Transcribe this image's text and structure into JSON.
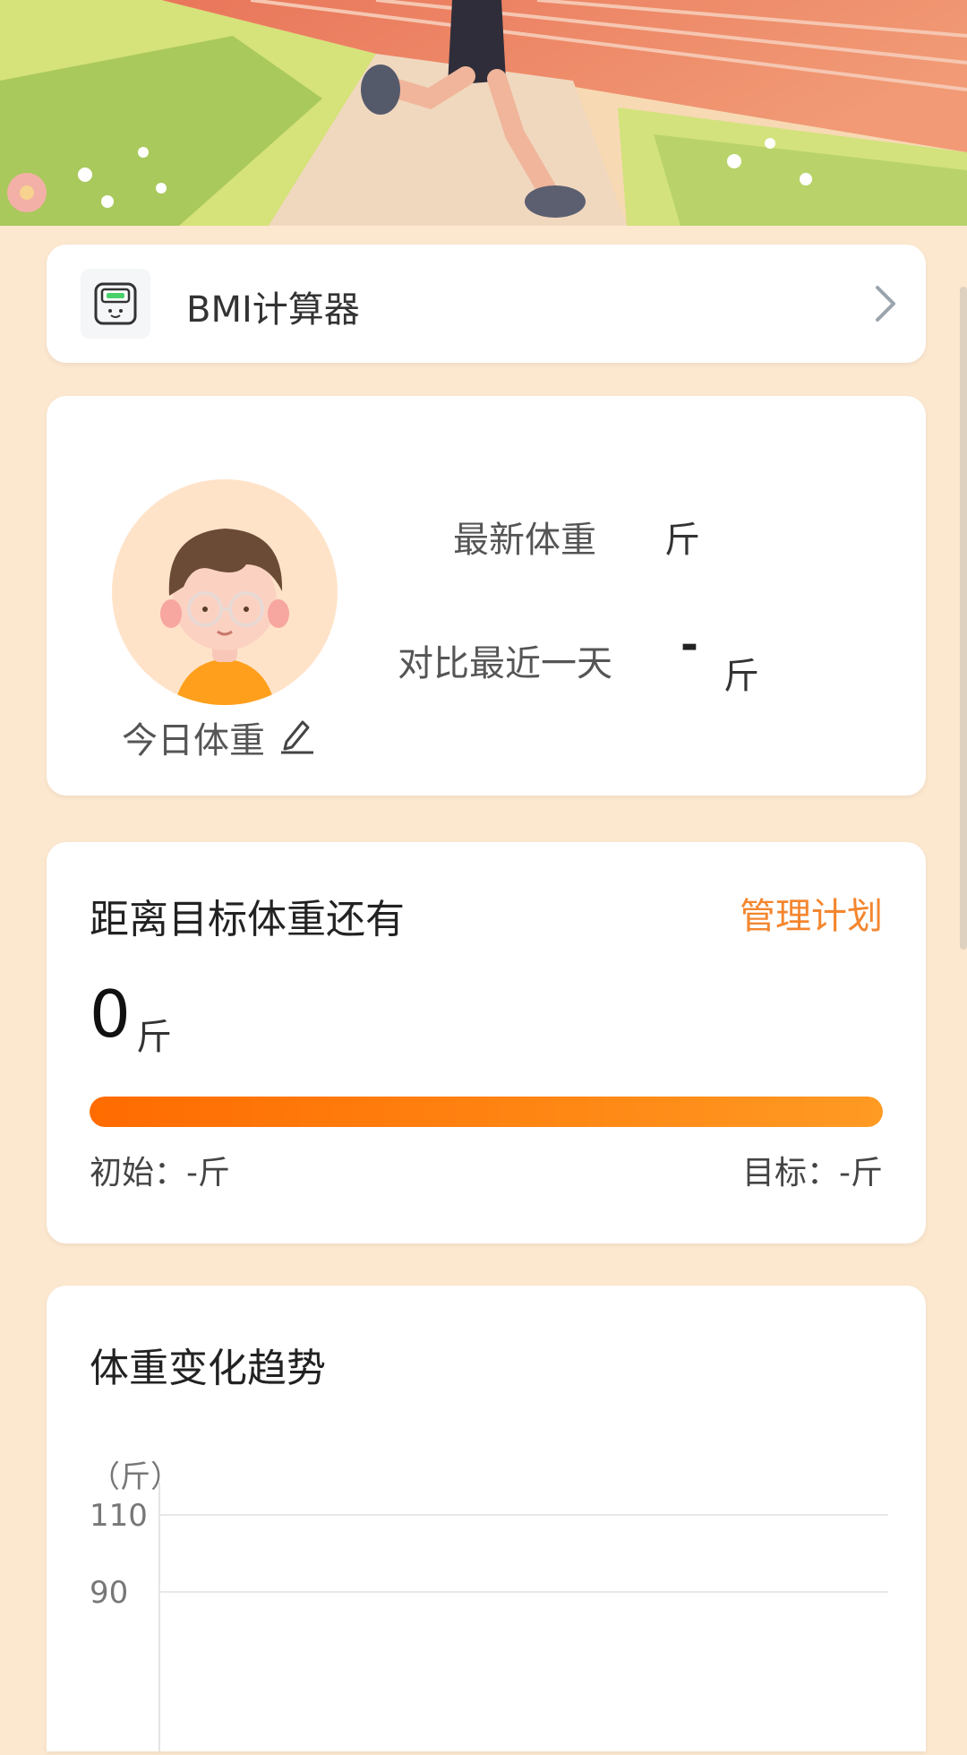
{
  "bmi": {
    "label": "BMI计算器"
  },
  "weight": {
    "latest_label": "最新体重",
    "latest_unit": "斤",
    "compare_label": "对比最近一天",
    "compare_value": "-",
    "compare_unit": "斤",
    "today_label": "今日体重"
  },
  "goal": {
    "title": "距离目标体重还有",
    "manage_label": "管理计划",
    "value": "0",
    "unit": "斤",
    "progress": 1.0,
    "initial": "初始：-斤",
    "target": "目标：-斤"
  },
  "trend": {
    "title": "体重变化趋势",
    "unit": "（斤）"
  },
  "colors": {
    "background": "#FCE8CF",
    "accent": "#F4862F",
    "progress_start": "#FF6B00",
    "progress_end": "#FF9A22"
  },
  "chart_data": {
    "type": "line",
    "title": "体重变化趋势",
    "ylabel": "（斤）",
    "yticks": [
      110,
      90
    ],
    "series": [],
    "grid": true
  }
}
